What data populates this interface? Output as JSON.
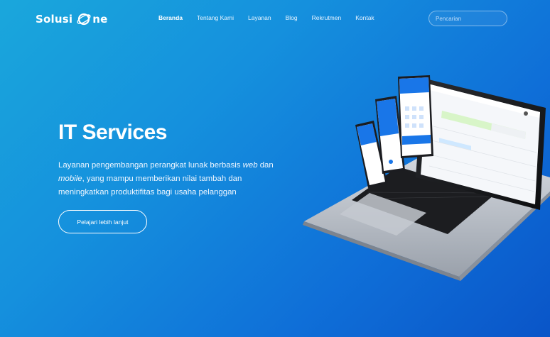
{
  "brand": {
    "name_prefix": "Solusi",
    "name_suffix": "ne"
  },
  "nav": {
    "items": [
      {
        "label": "Beranda",
        "active": true
      },
      {
        "label": "Tentang Kami",
        "active": false
      },
      {
        "label": "Layanan",
        "active": false
      },
      {
        "label": "Blog",
        "active": false
      },
      {
        "label": "Rekrutmen",
        "active": false
      },
      {
        "label": "Kontak",
        "active": false
      }
    ]
  },
  "search": {
    "placeholder": "Pencarian"
  },
  "hero": {
    "title": "IT Services",
    "desc_part1": "Layanan pengembangan perangkat lunak berbasis ",
    "desc_web": "web",
    "desc_part2": " dan ",
    "desc_mobile": "mobile",
    "desc_part3": ", yang mampu memberikan nilai tambah dan meningkatkan produktifitas bagi usaha pelanggan",
    "cta_label": "Pelajari lebih lanjut"
  },
  "colors": {
    "bg_start": "#1aa7dc",
    "bg_end": "#0a55c8",
    "text": "#ffffff"
  }
}
